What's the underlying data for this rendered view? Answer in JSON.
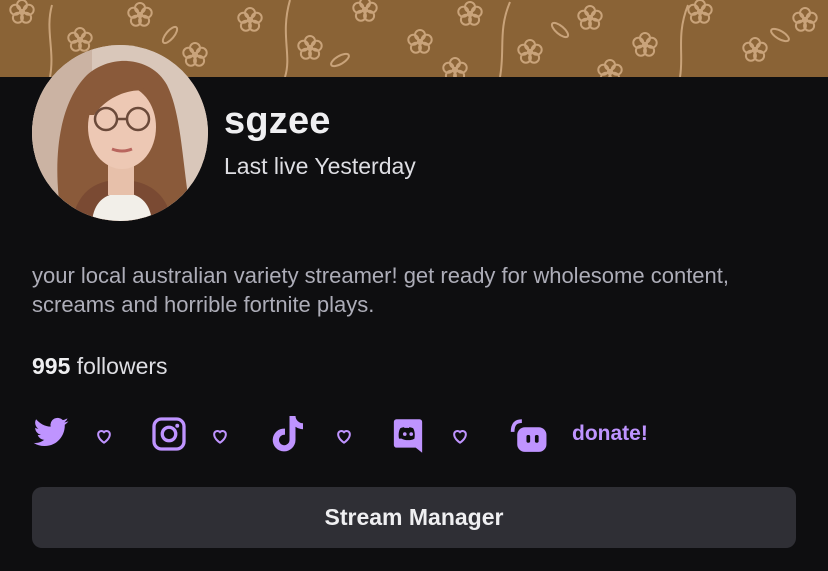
{
  "profile": {
    "username": "sgzee",
    "last_live": "Last live Yesterday",
    "bio": "your local australian variety streamer! get ready for wholesome content, screams and horrible fortnite plays.",
    "followers_count": "995",
    "followers_label": " followers"
  },
  "socials": [
    {
      "icon": "twitter-icon",
      "favorite_icon": "heart-icon"
    },
    {
      "icon": "instagram-icon",
      "favorite_icon": "heart-icon"
    },
    {
      "icon": "tiktok-icon",
      "favorite_icon": "heart-icon"
    },
    {
      "icon": "discord-icon",
      "favorite_icon": "heart-icon"
    },
    {
      "icon": "streamlabs-icon",
      "label": "donate!"
    }
  ],
  "actions": {
    "stream_manager_label": "Stream Manager"
  },
  "colors": {
    "background": "#0e0e10",
    "banner": "#8a6336",
    "accent": "#bf94ff",
    "button_bg": "#2f2f35",
    "text_primary": "#efeff1",
    "text_secondary": "#adadb8"
  }
}
